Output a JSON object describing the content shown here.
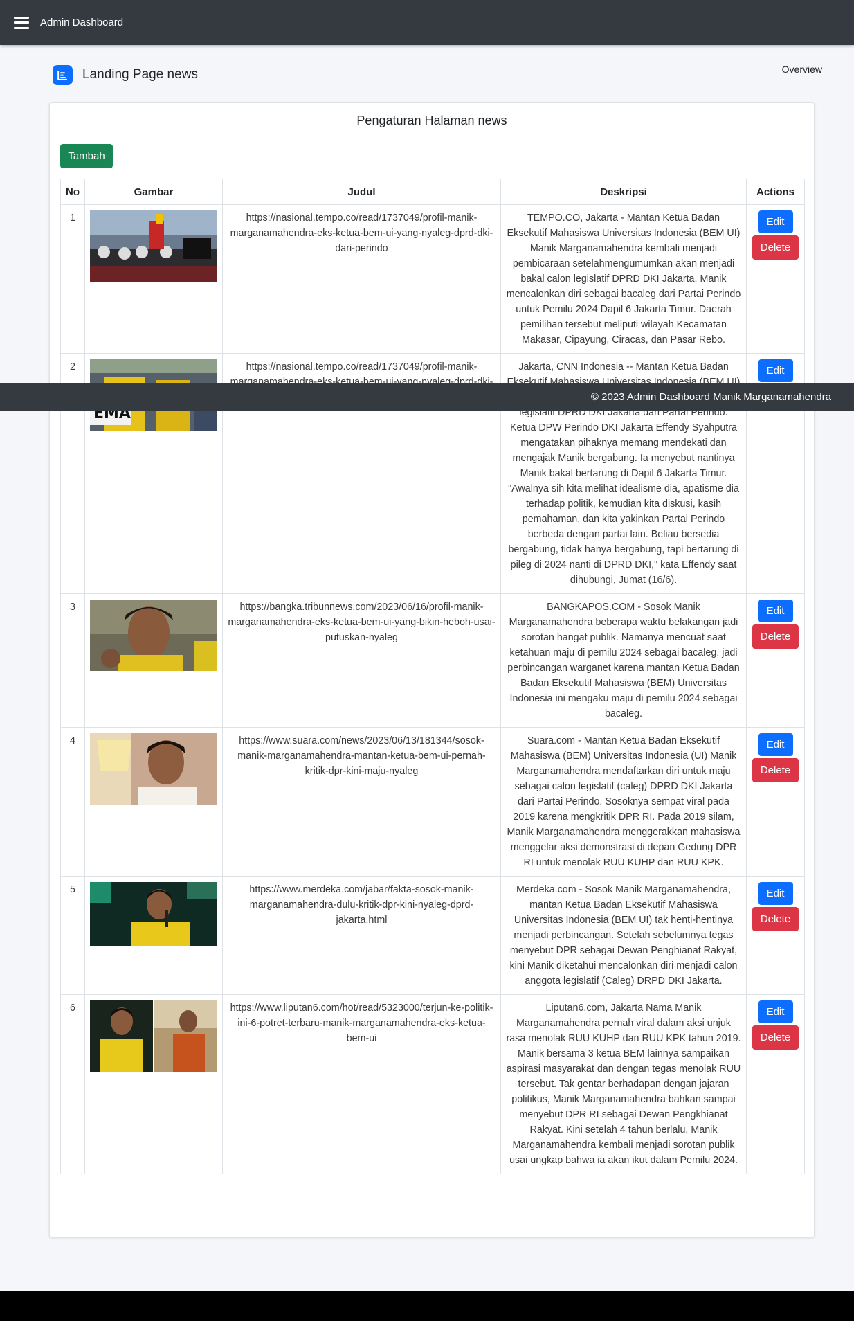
{
  "navbar": {
    "brand": "Admin Dashboard",
    "menu_icon": "hamburger-menu-icon"
  },
  "header": {
    "title": "Landing Page news",
    "title_icon": "chart-icon",
    "overview_link": "Overview"
  },
  "card": {
    "title": "Pengaturan Halaman news",
    "add_button": "Tambah"
  },
  "table": {
    "columns": [
      "No",
      "Gambar",
      "Judul",
      "Deskripsi",
      "Actions"
    ],
    "edit_label": "Edit",
    "delete_label": "Delete",
    "rows": [
      {
        "no": "1",
        "judul": "https://nasional.tempo.co/read/1737049/profil-manik-marganamahendra-eks-ketua-bem-ui-yang-nyaleg-dprd-dki-dari-perindo",
        "deskripsi": "TEMPO.CO, Jakarta - Mantan Ketua Badan Eksekutif Mahasiswa Universitas Indonesia (BEM UI) Manik Marganamahendra kembali menjadi pembicaraan setelahmengumumkan akan menjadi bakal calon legislatif DPRD DKI Jakarta. Manik mencalonkan diri sebagai bacaleg dari Partai Perindo untuk Pemilu 2024 Dapil 6 Jakarta Timur. Daerah pemilihan tersebut meliputi wilayah Kecamatan Makasar, Cipayung, Ciracas, dan Pasar Rebo."
      },
      {
        "no": "2",
        "judul": "https://nasional.tempo.co/read/1737049/profil-manik-marganamahendra-eks-ketua-bem-ui-yang-nyaleg-dprd-dki-dari-perindo",
        "deskripsi": "Jakarta, CNN Indonesia -- Mantan Ketua Badan Eksekutif Mahasiswa Universitas Indonesia (BEM UI) Manik Marganamahendra menjadi bakal calon legislatif DPRD DKI Jakarta dari Partai Perindo. Ketua DPW Perindo DKI Jakarta Effendy Syahputra mengatakan pihaknya memang mendekati dan mengajak Manik bergabung. Ia menyebut nantinya Manik bakal bertarung di Dapil 6 Jakarta Timur. \"Awalnya sih kita melihat idealisme dia, apatisme dia terhadap politik, kemudian kita diskusi, kasih pemahaman, dan kita yakinkan Partai Perindo berbeda dengan partai lain. Beliau bersedia bergabung, tidak hanya bergabung, tapi bertarung di pileg di 2024 nanti di DPRD DKI,\" kata Effendy saat dihubungi, Jumat (16/6)."
      },
      {
        "no": "3",
        "judul": "https://bangka.tribunnews.com/2023/06/16/profil-manik-marganamahendra-eks-ketua-bem-ui-yang-bikin-heboh-usai-putuskan-nyaleg",
        "deskripsi": "BANGKAPOS.COM - Sosok Manik Marganamahendra beberapa waktu belakangan jadi sorotan hangat publik. Namanya mencuat saat ketahuan maju di pemilu 2024 sebagai bacaleg. jadi perbincangan warganet karena mantan Ketua Badan Badan Eksekutif Mahasiswa (BEM) Universitas Indonesia ini mengaku maju di pemilu 2024 sebagai bacaleg."
      },
      {
        "no": "4",
        "judul": "https://www.suara.com/news/2023/06/13/181344/sosok-manik-marganamahendra-mantan-ketua-bem-ui-pernah-kritik-dpr-kini-maju-nyaleg",
        "deskripsi": "Suara.com - Mantan Ketua Badan Eksekutif Mahasiswa (BEM) Universitas Indonesia (UI) Manik Marganamahendra mendaftarkan diri untuk maju sebagai calon legislatif (caleg) DPRD DKI Jakarta dari Partai Perindo. Sosoknya sempat viral pada 2019 karena mengkritik DPR RI. Pada 2019 silam, Manik Marganamahendra menggerakkan mahasiswa menggelar aksi demonstrasi di depan Gedung DPR RI untuk menolak RUU KUHP dan RUU KPK."
      },
      {
        "no": "5",
        "judul": "https://www.merdeka.com/jabar/fakta-sosok-manik-marganamahendra-dulu-kritik-dpr-kini-nyaleg-dprd-jakarta.html",
        "deskripsi": "Merdeka.com - Sosok Manik Marganamahendra, mantan Ketua Badan Eksekutif Mahasiswa Universitas Indonesia (BEM UI) tak henti-hentinya menjadi perbincangan. Setelah sebelumnya tegas menyebut DPR sebagai Dewan Penghianat Rakyat, kini Manik diketahui mencalonkan diri menjadi calon anggota legislatif (Caleg) DRPD DKI Jakarta."
      },
      {
        "no": "6",
        "judul": "https://www.liputan6.com/hot/read/5323000/terjun-ke-politik-ini-6-potret-terbaru-manik-marganamahendra-eks-ketua-bem-ui",
        "deskripsi": "Liputan6.com, Jakarta Nama Manik Marganamahendra pernah viral dalam aksi unjuk rasa menolak RUU KUHP dan RUU KPK tahun 2019. Manik bersama 3 ketua BEM lainnya sampaikan aspirasi masyarakat dan dengan tegas menolak RUU tersebut. Tak gentar berhadapan dengan jajaran politikus, Manik Marganamahendra bahkan sampai menyebut DPR RI sebagai Dewan Pengkhianat Rakyat. Kini setelah 4 tahun berlalu, Manik Marganamahendra kembali menjadi sorotan publik usai ungkap bahwa ia akan ikut dalam Pemilu 2024."
      }
    ]
  },
  "footer": {
    "text": "© 2023 Admin Dashboard Manik Marganamahendra"
  },
  "colors": {
    "navbar": "#343a40",
    "primary": "#0d6efd",
    "success": "#198754",
    "danger": "#dc3545"
  }
}
